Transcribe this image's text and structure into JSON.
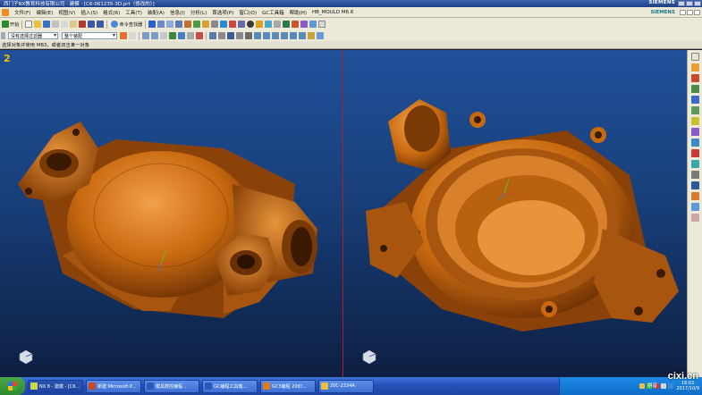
{
  "window": {
    "title": "西门子NX教育科技有限公司 · 建模 · [C6-061235-3D.prt（修改的）]",
    "brand": "SIEMENS"
  },
  "menu": [
    "文件(F)",
    "编辑(E)",
    "视图(V)",
    "插入(S)",
    "格式(R)",
    "工具(T)",
    "装配(A)",
    "信息(I)",
    "分析(L)",
    "首选项(P)",
    "窗口(O)",
    "GC工具箱",
    "帮助(H)",
    "HB_MOULD M6.6"
  ],
  "menu_brand": "SIEMENS",
  "toolbar1": {
    "start_label": "开始",
    "command_finder": "命令查找器"
  },
  "toolbar2": {
    "filter_combo": "没有选择过滤器",
    "scope_combo": "整个装配"
  },
  "cue_line": "选择对象并使用 MB3，或者双击某一对象",
  "viewport1": {
    "number": "2"
  },
  "taskbar": {
    "tasks": [
      {
        "label": "NX 8 - 建模 - [C6...",
        "icon_color": "#c8d84a",
        "active": true
      },
      {
        "label": "新建 Microsoft P...",
        "icon_color": "#c84a2a",
        "active": false
      },
      {
        "label": "模具数控编程...",
        "icon_color": "#2a5ab8",
        "active": false
      },
      {
        "label": "GC编程工具箱...",
        "icon_color": "#2a5ab8",
        "active": false
      },
      {
        "label": "GC3编程 20ID...",
        "icon_color": "#e07a20",
        "active": false
      },
      {
        "label": "20C-2334A",
        "icon_color": "#e8c040",
        "active": false
      }
    ],
    "ime": "拼音",
    "time": "16:02",
    "date": "2017/10/9"
  },
  "watermark": "cixi.cn",
  "colors": {
    "part": "#c8690f",
    "viewport_top": "#20509a",
    "viewport_bottom": "#0d1f42",
    "split_line": "#b21c1c"
  }
}
